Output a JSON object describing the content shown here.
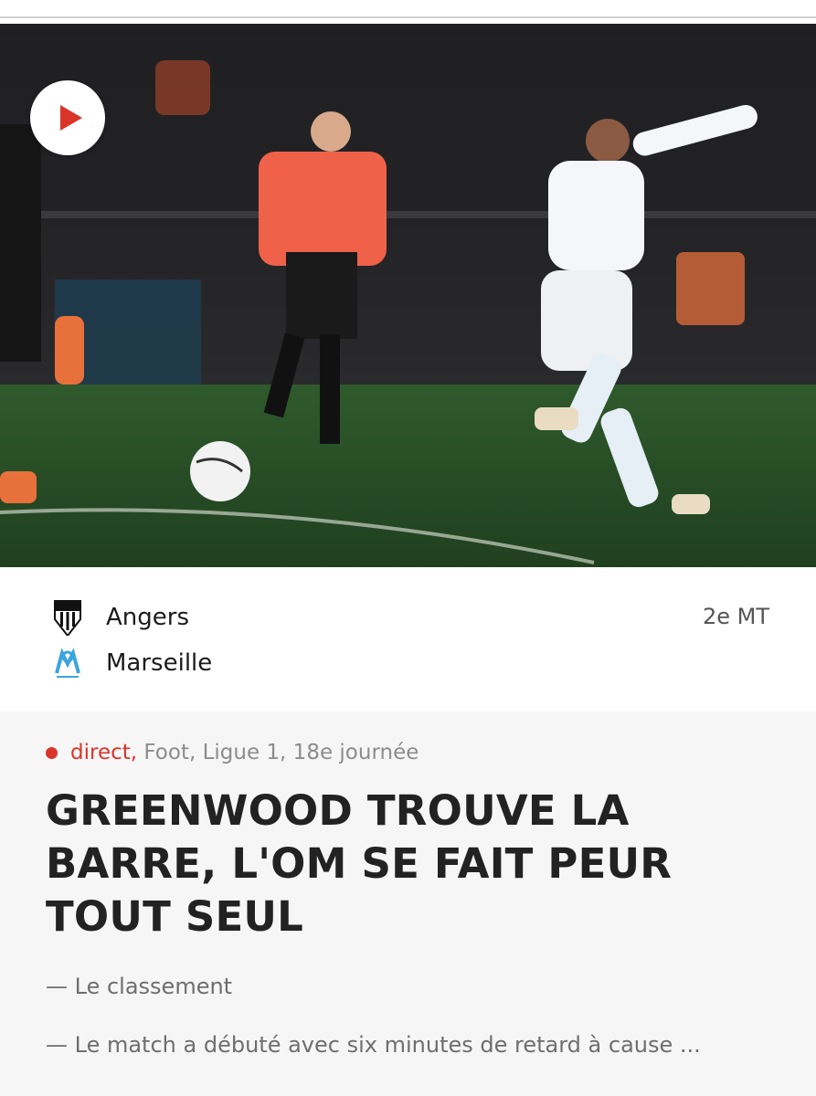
{
  "colors": {
    "accent": "#d9352a",
    "headline": "#222222",
    "muted": "#8c8c8c"
  },
  "hero": {
    "play_icon": "play-icon"
  },
  "match": {
    "home": {
      "name": "Angers",
      "logo": "angers-sco-crest"
    },
    "away": {
      "name": "Marseille",
      "logo": "om-crest"
    },
    "status": "2e MT"
  },
  "article": {
    "live_label": "direct,",
    "breadcrumb": " Foot, Ligue 1, 18e journée",
    "headline": "GREENWOOD TROUVE LA BARRE, L'OM SE FAIT PEUR TOUT SEUL",
    "links": [
      "— Le classement",
      "— Le match a débuté avec six minutes de retard à cause ..."
    ]
  }
}
